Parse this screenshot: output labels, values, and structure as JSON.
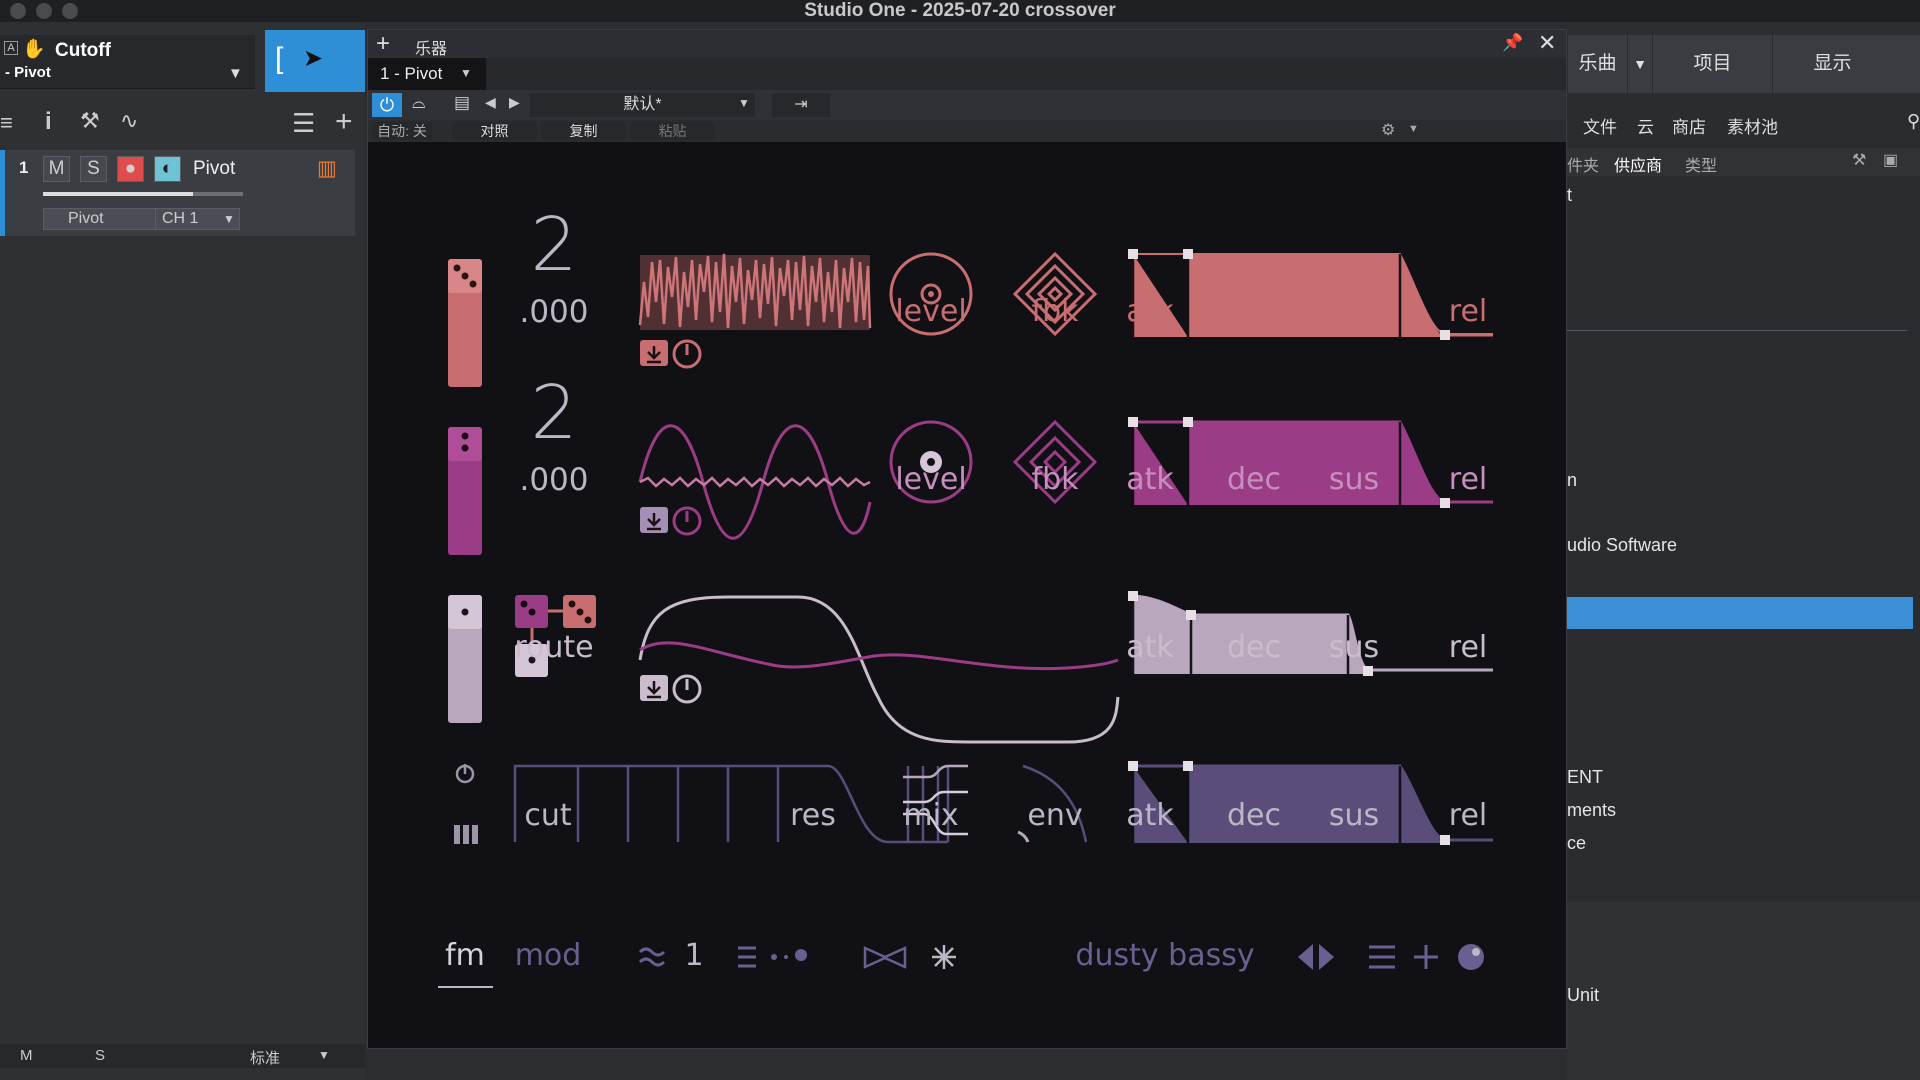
{
  "app": {
    "window_title": "Studio One - 2025-07-20 crossover"
  },
  "inspector": {
    "param": "Cutoff",
    "device": "- Pivot"
  },
  "track": {
    "number": "1",
    "mute": "M",
    "solo": "S",
    "name": "Pivot",
    "instrument": "Pivot",
    "channel": "CH 1"
  },
  "bottom_bar": {
    "m": "M",
    "s": "S",
    "mode": "标准"
  },
  "right_tabs": [
    "乐曲",
    "项目",
    "显示"
  ],
  "right_menu": [
    "文件",
    "云",
    "商店",
    "素材池"
  ],
  "right_sub": [
    "件夹",
    "供应商",
    "类型"
  ],
  "right_list": [
    "t",
    "n",
    "udio Software",
    "ENT",
    "ments",
    "ce",
    "Unit"
  ],
  "plugin_window": {
    "title": "乐器",
    "instance": "1 - Pivot",
    "preset": "默认*",
    "auto": "自动: 关",
    "compare": "对照",
    "copy": "复制",
    "paste": "粘贴"
  },
  "synth": {
    "osc1": {
      "coarse": "2",
      "fine": ".000",
      "level": "level",
      "fbk": "fbk"
    },
    "osc2": {
      "coarse": "2",
      "fine": ".000",
      "level": "level",
      "fbk": "fbk"
    },
    "route": "route",
    "filter": {
      "cut": "cut",
      "res": "res",
      "mix": "mix",
      "env": "env"
    },
    "env_labels": [
      "atk",
      "dec",
      "sus",
      "rel"
    ],
    "footer": {
      "tab_fm": "fm",
      "tab_mod": "mod",
      "voices": "1",
      "patch_name": "dusty bassy"
    },
    "colors": {
      "osc1": "#c86e70",
      "osc2": "#9b3c86",
      "mod": "#b9a8bd",
      "filter": "#5a4d7a"
    }
  }
}
